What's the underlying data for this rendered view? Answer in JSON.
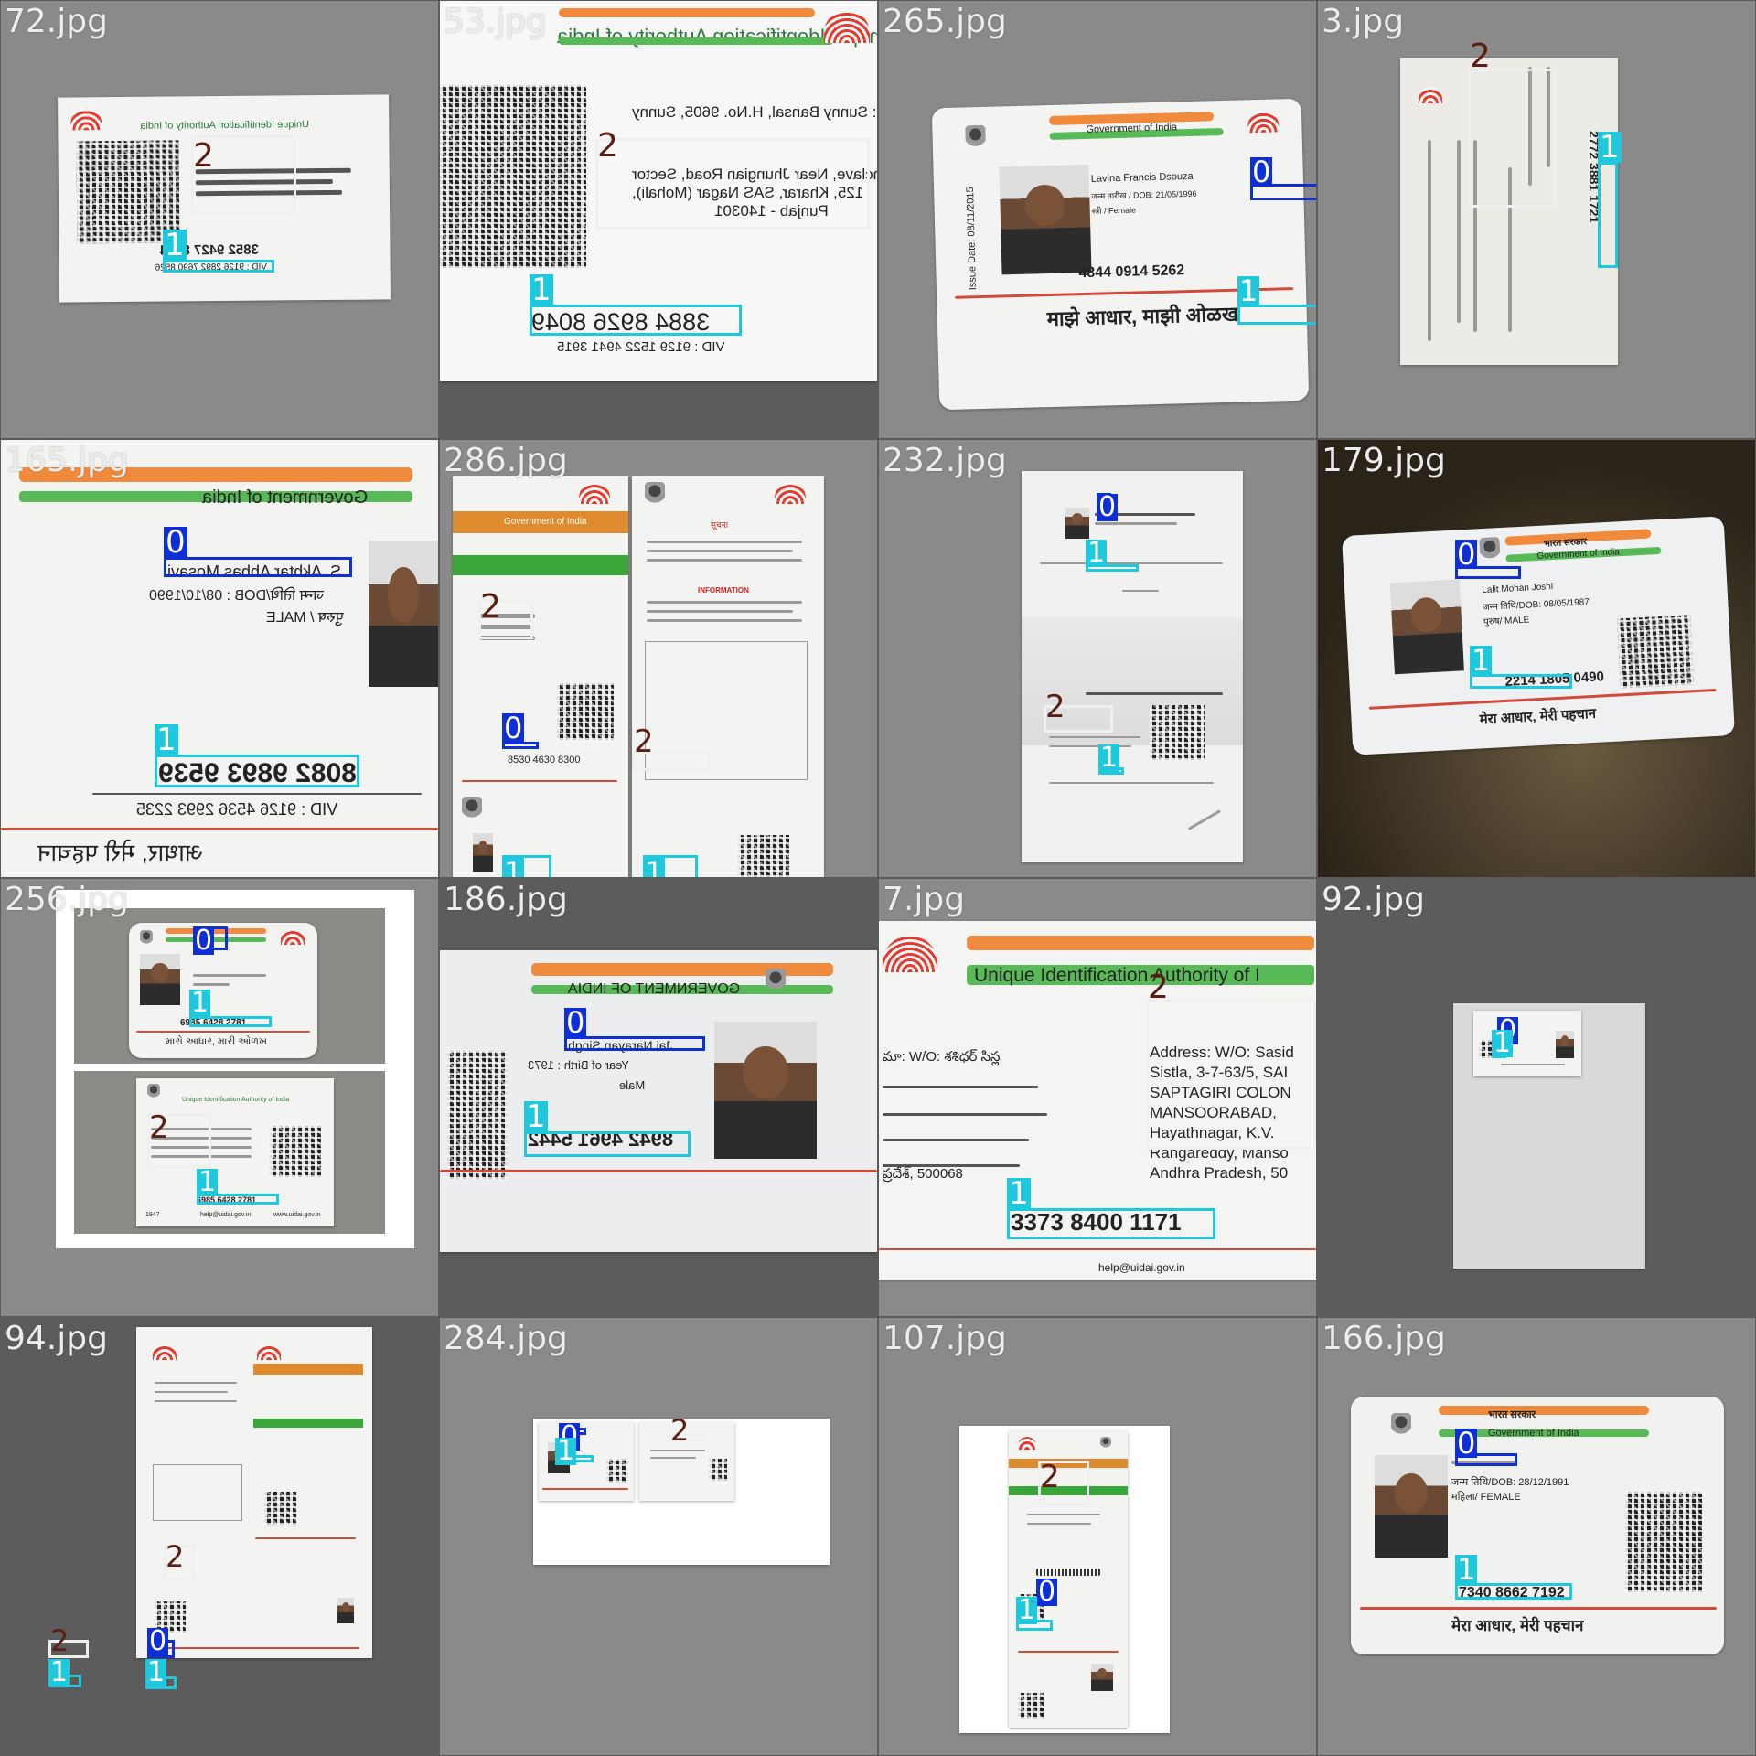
{
  "class_colors": {
    "0": "#0f2fd6",
    "1": "#1ec9de",
    "2": "#efefef"
  },
  "tiles": [
    {
      "file": "72.jpg",
      "text": {
        "number": "3852 9427 8164",
        "vid": "VID : 9126 2892 7690 8526",
        "auth": "Unique Identification Authority of India"
      }
    },
    {
      "file": "53.jpg",
      "text": {
        "number": "3884 8926 8049",
        "vid": "VID : 9129 1522 4941 3915",
        "auth": "Unique Identification Authority of India",
        "addr1": "S/O: Sunny Bansal, H.No. 9605, Sunny",
        "addr2": "Enclave, Near Jhungian Road, Sector",
        "addr3": "125, Kharar, SAS Nagar (Mohali),",
        "addr4": "Punjab - 140301"
      }
    },
    {
      "file": "265.jpg",
      "text": {
        "name": "Lavina Francis Dsouza",
        "dob": "जन्म तारीख / DOB: 21/05/1996",
        "gender": "स्त्री / Female",
        "number": "4844 0914 5262",
        "tagline": "माझे आधार, माझी ओळख",
        "issue": "Issue Date: 08/11/2015",
        "gov": "Government of India"
      }
    },
    {
      "file": "3.jpg",
      "text": {
        "number": "2772 3881 1721"
      }
    },
    {
      "file": "165.jpg",
      "text": {
        "name": "S. Akhtar Abbas Mosavi",
        "dob": "जन्म तिथि/DOB : 08/10/1990",
        "gender": "पुरुष / MALE",
        "number": "8082 9893 9539",
        "vid": "VID : 9126 4536 2993 2235",
        "gov": "Government of India",
        "tagline": "आधार, मेरी पहचान"
      }
    },
    {
      "file": "286.jpg",
      "text": {
        "number": "8530 4630 8300",
        "gov": "Government of India",
        "info": "INFORMATION"
      }
    },
    {
      "file": "232.jpg",
      "text": {}
    },
    {
      "file": "179.jpg",
      "text": {
        "name": "Lalit Mohan Joshi",
        "dob": "जन्म तिथि/DOB: 08/05/1987",
        "gender": "पुरुष/ MALE",
        "number": "2214 1805 0490",
        "gov": "भारत सरकार",
        "gov_en": "Government of India",
        "tagline": "मेरा आधार, मेरी पहचान"
      }
    },
    {
      "file": "256.jpg",
      "text": {
        "number": "6985 6428 2781",
        "tagline": "મારો આધાર, મારી ઓળખ",
        "auth": "Unique Identification Authority of India",
        "email": "help@uidai.gov.in",
        "web": "www.uidai.gov.in",
        "phone": "1947"
      }
    },
    {
      "file": "186.jpg",
      "text": {
        "name": "Jai Narayan Singh",
        "yob": "Year of Birth : 1973",
        "gender": "Male",
        "number": "8942 4961 5442",
        "gov": "GOVERNMENT OF INDIA"
      }
    },
    {
      "file": "7.jpg",
      "text": {
        "auth": "Unique Identification Authority of I",
        "addr": [
          "Address: W/O: Sasid",
          "Sistla, 3-7-63/5, SAI",
          "SAPTAGIRI COLON",
          "MANSOORABAD,",
          "Hayathnagar, K.V.",
          "Rangareddy, Manso",
          "Andhra Pradesh, 50"
        ],
        "number": "3373 8400 1171",
        "telugu_pin": "ప్రదేశ్, 500068",
        "telugu1": "మా: W/O: శశిధర్ సిస్ల",
        "web": "help@uidai.gov.in"
      }
    },
    {
      "file": "92.jpg",
      "text": {}
    },
    {
      "file": "94.jpg",
      "text": {}
    },
    {
      "file": "284.jpg",
      "text": {}
    },
    {
      "file": "107.jpg",
      "text": {}
    },
    {
      "file": "166.jpg",
      "text": {
        "dob": "जन्म तिथि/DOB: 28/12/1991",
        "gender": "महिला/ FEMALE",
        "number": "7340 8662 7192",
        "gov": "भारत सरकार",
        "gov_en": "Government of India",
        "tagline": "मेरा आधार, मेरी पहचान"
      }
    }
  ]
}
